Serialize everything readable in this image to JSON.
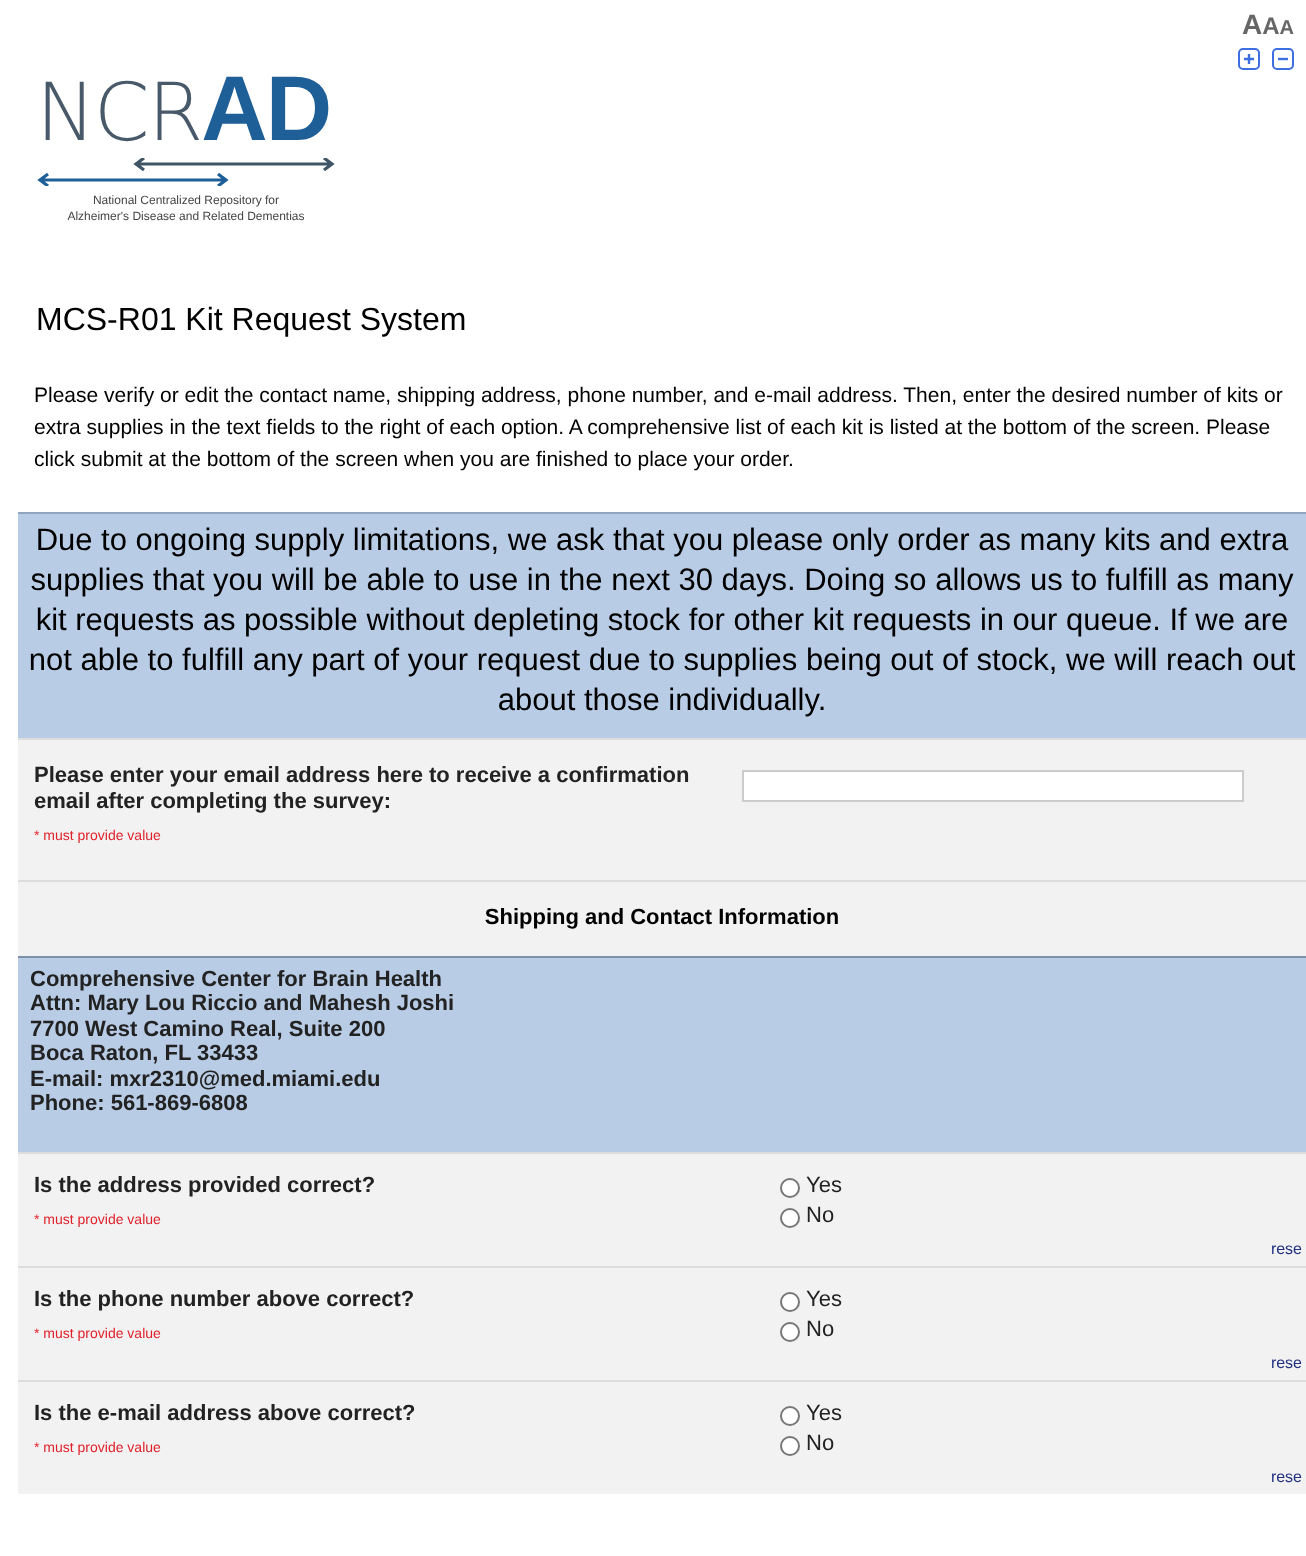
{
  "logo": {
    "thin": "NCR",
    "bold": "AD",
    "subtitle_lines": [
      "National Centralized Repository for",
      "Alzheimer's Disease and Related Dementias"
    ]
  },
  "text_size": {
    "letters": [
      "A",
      "A",
      "A"
    ]
  },
  "title": "MCS-R01 Kit Request System",
  "intro": "Please verify or edit the contact name, shipping address, phone number, and e-mail address. Then, enter the desired number of kits or extra supplies in the text fields to the right of each option. A comprehensive list of each kit is listed at the bottom of the screen. Please click submit at the bottom of the screen when you are finished to place your order.",
  "notice": "Due to ongoing supply limitations, we ask that you please only order as many kits and extra supplies that you will be able to use in the next 30 days. Doing so allows us to fulfill as many kit requests as possible without depleting stock for other kit requests in our queue. If we are not able to fulfill any part of your request due to supplies being out of stock, we will reach out about those individually.",
  "email_field": {
    "label": "Please enter your email address here to receive a confirmation email after completing the survey:",
    "required": "* must provide value"
  },
  "section_header": "Shipping and Contact Information",
  "contact_lines": [
    "Comprehensive Center for Brain Health",
    "Attn: Mary Lou Riccio and Mahesh Joshi",
    "7700 West Camino Real, Suite 200",
    "Boca Raton, FL 33433",
    "E-mail: mxr2310@med.miami.edu",
    "Phone: 561-869-6808"
  ],
  "questions": [
    {
      "label": "Is the address provided correct?",
      "required": "* must provide value",
      "options": [
        {
          "label": "Yes",
          "selected": false
        },
        {
          "label": "No",
          "selected": false
        }
      ],
      "reset": "rese"
    },
    {
      "label": "Is the phone number above correct?",
      "required": "* must provide value",
      "options": [
        {
          "label": "Yes",
          "selected": false
        },
        {
          "label": "No",
          "selected": false
        }
      ],
      "reset": "rese"
    },
    {
      "label": "Is the e-mail address above correct?",
      "required": "* must provide value",
      "options": [
        {
          "label": "Yes",
          "selected": false
        },
        {
          "label": "No",
          "selected": false
        }
      ],
      "reset": "rese"
    }
  ]
}
